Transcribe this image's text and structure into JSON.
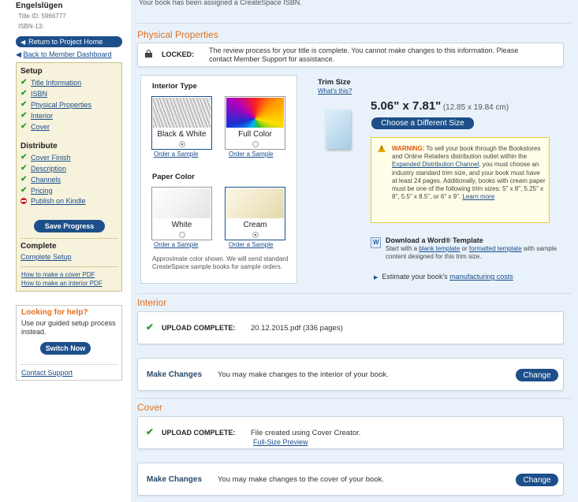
{
  "sidebar": {
    "book_title": "Engelslügen",
    "title_id": "Title ID: 5966777",
    "isbn13": "ISBN-13:  ",
    "return_project": "Return to Project Home",
    "back_member": "Back to Member Dashboard",
    "setup_heading": "Setup",
    "setup_items": [
      "Title Information",
      "ISBN",
      "Physical Properties",
      "Interior",
      "Cover"
    ],
    "distribute_heading": "Distribute",
    "distribute_items": [
      "Cover Finish",
      "Description",
      "Channels",
      "Pricing"
    ],
    "kindle_item": "Publish on Kindle",
    "save_progress": "Save Progress",
    "complete_heading": "Complete",
    "complete_setup": "Complete Setup",
    "make_cover_pdf": "How to make a cover PDF",
    "make_interior_pdf": "How to make an interior PDF",
    "help_title": "Looking for help?",
    "help_text": "Use our guided setup process instead.",
    "switch_now": "Switch Now",
    "contact_support": "Contact Support"
  },
  "main": {
    "top_note": "Your book has been assigned a CreateSpace ISBN.",
    "physical_title": "Physical Properties",
    "locked_label": "LOCKED:",
    "locked_text": "The review process for your title is complete. You cannot make changes to this information. Please contact Member Support for assistance.",
    "interior_type_heading": "Interior Type",
    "bw_label": "Black & White",
    "fc_label": "Full Color",
    "order_sample": "Order a Sample",
    "paper_color_heading": "Paper Color",
    "white_label": "White",
    "cream_label": "Cream",
    "swatch_note": "Approximate color shown. We will send standard CreateSpace sample books for sample orders.",
    "trim_size_label": "Trim Size",
    "whats_this": "What's this?",
    "trim_value": "5.06\" x 7.81\"",
    "trim_metric": "(12.85 x 19.84 cm)",
    "choose_size": "Choose a Different Size",
    "warning_label": "WARNING:",
    "warning_text_1": "To sell your book through the Bookstores and Online Retailers distribution outlet within the",
    "warning_link": "Expanded Distribution Channel",
    "warning_text_2": ", you must choose an industry standard trim size, and your book must have at least 24 pages. Additionally, books with cream paper must be one of the following trim sizes: 5\" x 8\", 5.25\" x 8\", 5.5\" x 8.5\", or 6\" x 9\".",
    "learn_more": "Learn more",
    "download_template": "Download a Word® Template",
    "template_text_1": "Start with a",
    "blank_template": "blank template",
    "template_or": "or",
    "formatted_template": "formatted template",
    "template_text_2": "with sample content designed for this trim size.",
    "estimate_text": "Estimate your book's",
    "manufacturing_costs": "manufacturing costs",
    "interior_title": "Interior",
    "upload_complete": "UPLOAD COMPLETE:",
    "interior_file": "20.12.2015.pdf (336 pages)",
    "make_changes": "Make Changes",
    "interior_change_text": "You may make changes to the interior of your book.",
    "change_btn": "Change",
    "cover_title": "Cover",
    "cover_file": "File created using Cover Creator.",
    "full_size_preview": "Full-Size Preview",
    "cover_change_text": "You may make changes to the cover of your book."
  },
  "colors": {
    "accent_orange": "#e07020",
    "button_blue": "#1d4f8a",
    "panel_bg": "#e9f2fa",
    "check_green": "#2d9e2d"
  }
}
